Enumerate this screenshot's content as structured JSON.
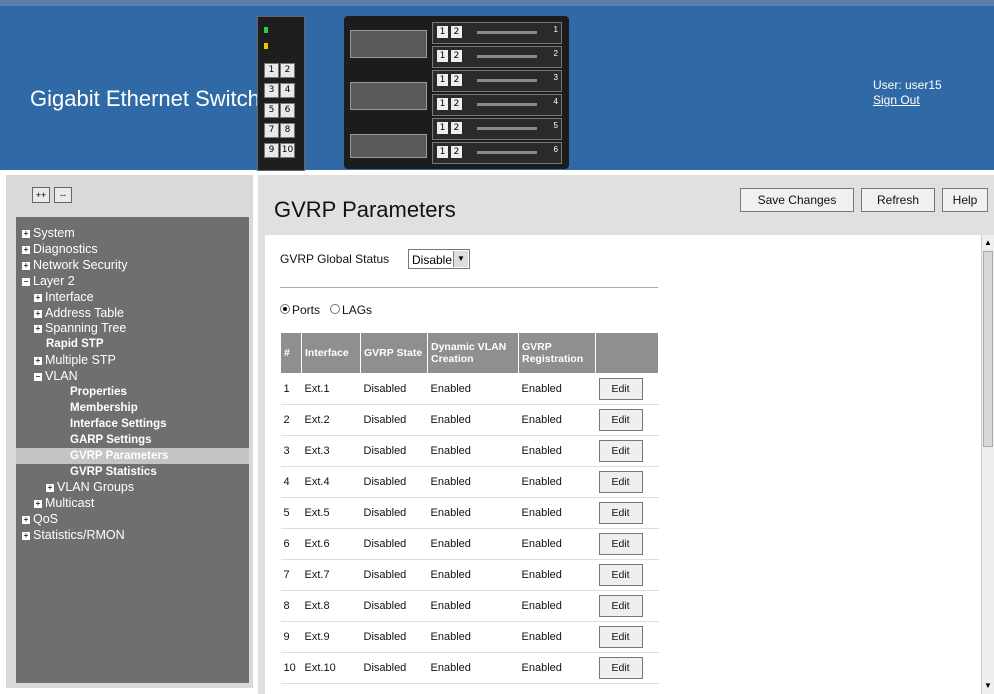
{
  "app": {
    "title": "Gigabit Ethernet Switch",
    "user_label": "User: user15",
    "sign_out": "Sign Out"
  },
  "device": {
    "port_pairs": [
      [
        "1",
        "2"
      ],
      [
        "3",
        "4"
      ],
      [
        "5",
        "6"
      ],
      [
        "7",
        "8"
      ],
      [
        "9",
        "10"
      ]
    ],
    "blades": [
      {
        "a": "1",
        "b": "2",
        "num": "1"
      },
      {
        "a": "1",
        "b": "2",
        "num": "2"
      },
      {
        "a": "1",
        "b": "2",
        "num": "3"
      },
      {
        "a": "1",
        "b": "2",
        "num": "4"
      },
      {
        "a": "1",
        "b": "2",
        "num": "5"
      },
      {
        "a": "1",
        "b": "2",
        "num": "6"
      }
    ]
  },
  "sidebar": {
    "expand_all": "++",
    "collapse_all": "--",
    "items": [
      {
        "label": "System",
        "level": 0,
        "icon": "+",
        "bold": false,
        "active": false
      },
      {
        "label": "Diagnostics",
        "level": 0,
        "icon": "+",
        "bold": false,
        "active": false
      },
      {
        "label": "Network Security",
        "level": 0,
        "icon": "+",
        "bold": false,
        "active": false
      },
      {
        "label": "Layer 2",
        "level": 0,
        "icon": "−",
        "bold": false,
        "active": false
      },
      {
        "label": "Interface",
        "level": 1,
        "icon": "+",
        "bold": false,
        "active": false
      },
      {
        "label": "Address Table",
        "level": 1,
        "icon": "+",
        "bold": false,
        "active": false
      },
      {
        "label": "Spanning Tree",
        "level": 1,
        "icon": "+",
        "bold": false,
        "active": false
      },
      {
        "label": "Rapid STP",
        "level": 2,
        "icon": "",
        "bold": true,
        "active": false
      },
      {
        "label": "Multiple STP",
        "level": 1,
        "icon": "+",
        "bold": false,
        "active": false
      },
      {
        "label": "VLAN",
        "level": 1,
        "icon": "−",
        "bold": false,
        "active": false
      },
      {
        "label": "Properties",
        "level": 3,
        "icon": "",
        "bold": true,
        "active": false
      },
      {
        "label": "Membership",
        "level": 3,
        "icon": "",
        "bold": true,
        "active": false
      },
      {
        "label": "Interface Settings",
        "level": 3,
        "icon": "",
        "bold": true,
        "active": false
      },
      {
        "label": "GARP Settings",
        "level": 3,
        "icon": "",
        "bold": true,
        "active": false
      },
      {
        "label": "GVRP Parameters",
        "level": 3,
        "icon": "",
        "bold": true,
        "active": true
      },
      {
        "label": "GVRP Statistics",
        "level": 3,
        "icon": "",
        "bold": true,
        "active": false
      },
      {
        "label": "VLAN Groups",
        "level": 2,
        "icon": "+",
        "bold": false,
        "active": false
      },
      {
        "label": "Multicast",
        "level": 1,
        "icon": "+",
        "bold": false,
        "active": false
      },
      {
        "label": "QoS",
        "level": 0,
        "icon": "+",
        "bold": false,
        "active": false
      },
      {
        "label": "Statistics/RMON",
        "level": 0,
        "icon": "+",
        "bold": false,
        "active": false
      }
    ]
  },
  "page": {
    "title": "GVRP Parameters",
    "buttons": {
      "save": "Save Changes",
      "refresh": "Refresh",
      "help": "Help"
    },
    "global_status_label": "GVRP Global Status",
    "global_status_value": "Disable",
    "radio_ports": "Ports",
    "radio_lags": "LAGs"
  },
  "table": {
    "headers": [
      "#",
      "Interface",
      "GVRP State",
      "Dynamic VLAN Creation",
      "GVRP Registration",
      ""
    ],
    "edit_label": "Edit",
    "rows": [
      [
        "1",
        "Ext.1",
        "Disabled",
        "Enabled",
        "Enabled"
      ],
      [
        "2",
        "Ext.2",
        "Disabled",
        "Enabled",
        "Enabled"
      ],
      [
        "3",
        "Ext.3",
        "Disabled",
        "Enabled",
        "Enabled"
      ],
      [
        "4",
        "Ext.4",
        "Disabled",
        "Enabled",
        "Enabled"
      ],
      [
        "5",
        "Ext.5",
        "Disabled",
        "Enabled",
        "Enabled"
      ],
      [
        "6",
        "Ext.6",
        "Disabled",
        "Enabled",
        "Enabled"
      ],
      [
        "7",
        "Ext.7",
        "Disabled",
        "Enabled",
        "Enabled"
      ],
      [
        "8",
        "Ext.8",
        "Disabled",
        "Enabled",
        "Enabled"
      ],
      [
        "9",
        "Ext.9",
        "Disabled",
        "Enabled",
        "Enabled"
      ],
      [
        "10",
        "Ext.10",
        "Disabled",
        "Enabled",
        "Enabled"
      ]
    ]
  }
}
